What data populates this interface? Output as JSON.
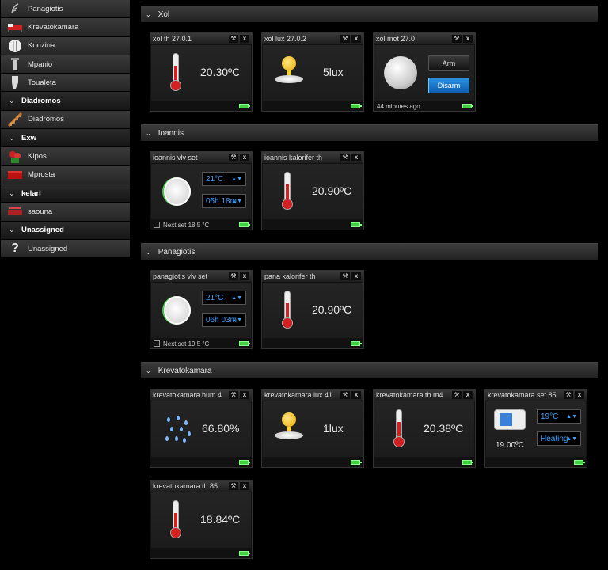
{
  "sidebar": {
    "items": [
      {
        "type": "room",
        "label": "Panagiotis",
        "icon": "feather-icon"
      },
      {
        "type": "room",
        "label": "Krevatokamara",
        "icon": "bed-icon"
      },
      {
        "type": "room",
        "label": "Kouzina",
        "icon": "kitchen-icon"
      },
      {
        "type": "room",
        "label": "Mpanio",
        "icon": "shower-icon"
      },
      {
        "type": "room",
        "label": "Toualeta",
        "icon": "toilet-icon"
      },
      {
        "type": "section",
        "label": "Diadromos"
      },
      {
        "type": "room",
        "label": "Diadromos",
        "icon": "stairs-icon"
      },
      {
        "type": "section",
        "label": "Exw"
      },
      {
        "type": "room",
        "label": "Kipos",
        "icon": "flowers-icon"
      },
      {
        "type": "room",
        "label": "Mprosta",
        "icon": "sofa-icon"
      },
      {
        "type": "section",
        "label": "kelari"
      },
      {
        "type": "room",
        "label": "saouna",
        "icon": "sauna-icon"
      },
      {
        "type": "section",
        "label": "Unassigned"
      },
      {
        "type": "room",
        "label": "Unassigned",
        "icon": "question-icon"
      }
    ]
  },
  "sections": {
    "xol": {
      "title": "Xol",
      "cards": {
        "th": {
          "title": "xol th 27.0.1",
          "value": "20.30ºC"
        },
        "lux": {
          "title": "xol lux 27.0.2",
          "value": "5lux"
        },
        "mot": {
          "title": "xol mot 27.0",
          "arm_label": "Arm",
          "disarm_label": "Disarm",
          "footer": "44 minutes ago"
        }
      }
    },
    "ioannis": {
      "title": "Ioannis",
      "cards": {
        "vlv": {
          "title": "ioannis vlv set",
          "temp_select": "21°C",
          "time_select": "05h 18m",
          "footer": "Next set 18.5 °C"
        },
        "kal": {
          "title": "ioannis kalorifer th",
          "value": "20.90ºC"
        }
      }
    },
    "panagiotis": {
      "title": "Panagiotis",
      "cards": {
        "vlv": {
          "title": "panagiotis vlv set",
          "temp_select": "21°C",
          "time_select": "06h 03m",
          "footer": "Next set 19.5 °C"
        },
        "kal": {
          "title": "pana kalorifer th",
          "value": "20.90ºC"
        }
      }
    },
    "krevatokamara": {
      "title": "Krevatokamara",
      "cards": {
        "hum": {
          "title": "krevatokamara hum 4",
          "value": "66.80%"
        },
        "lux": {
          "title": "krevatokamara lux 41",
          "value": "1lux"
        },
        "th": {
          "title": "krevatokamara th m4",
          "value": "20.38ºC"
        },
        "set": {
          "title": "krevatokamara set 85",
          "temp_select": "19°C",
          "mode_select": "Heating",
          "value": "19.00ºC"
        },
        "th85": {
          "title": "krevatokamara th 85",
          "value": "18.84ºC"
        }
      }
    }
  },
  "colors": {
    "accent_blue": "#3aa0ff",
    "battery_green": "#3fd13f",
    "thermo_red": "#d42020"
  }
}
